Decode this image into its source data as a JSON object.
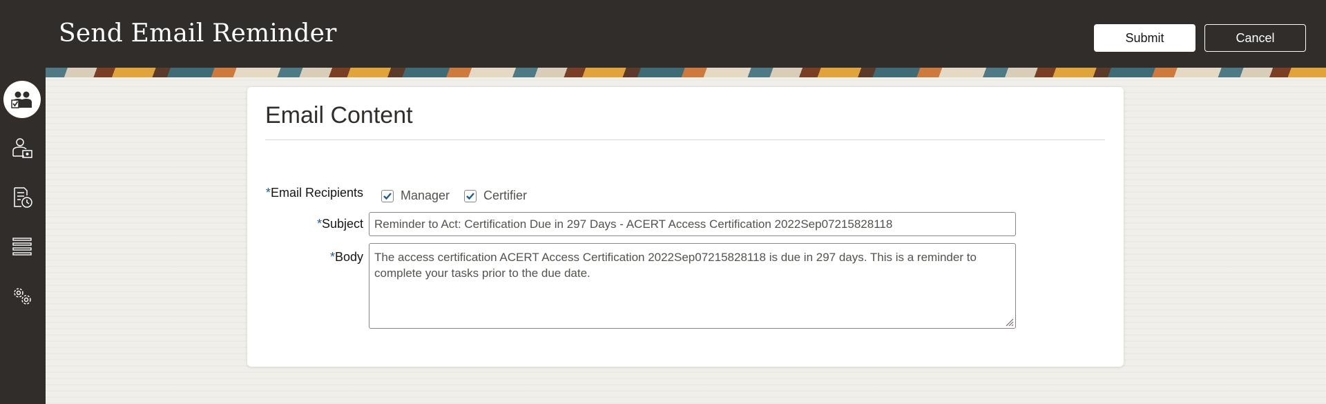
{
  "header": {
    "title": "Send Email Reminder",
    "submit_label": "Submit",
    "cancel_label": "Cancel"
  },
  "sidebar": {
    "items": [
      {
        "icon": "users-check-icon",
        "active": true
      },
      {
        "icon": "user-certificate-icon",
        "active": false
      },
      {
        "icon": "document-clock-icon",
        "active": false
      },
      {
        "icon": "list-icon",
        "active": false
      },
      {
        "icon": "gears-icon",
        "active": false
      }
    ]
  },
  "card": {
    "title": "Email Content",
    "recipients": {
      "required_mark": "*",
      "label": "Email Recipients",
      "options": [
        {
          "label": "Manager",
          "checked": true
        },
        {
          "label": "Certifier",
          "checked": true
        }
      ]
    },
    "subject": {
      "required_mark": "*",
      "label": "Subject",
      "value": "Reminder to Act: Certification Due in 297 Days - ACERT Access Certification 2022Sep07215828118"
    },
    "body": {
      "required_mark": "*",
      "label": "Body",
      "value": "The access certification ACERT Access Certification 2022Sep07215828118 is due in 297 days. This is a reminder to complete your tasks prior to the due date."
    }
  },
  "colors": {
    "header_bg": "#312d2a",
    "accent_check": "#1a5d9c"
  }
}
